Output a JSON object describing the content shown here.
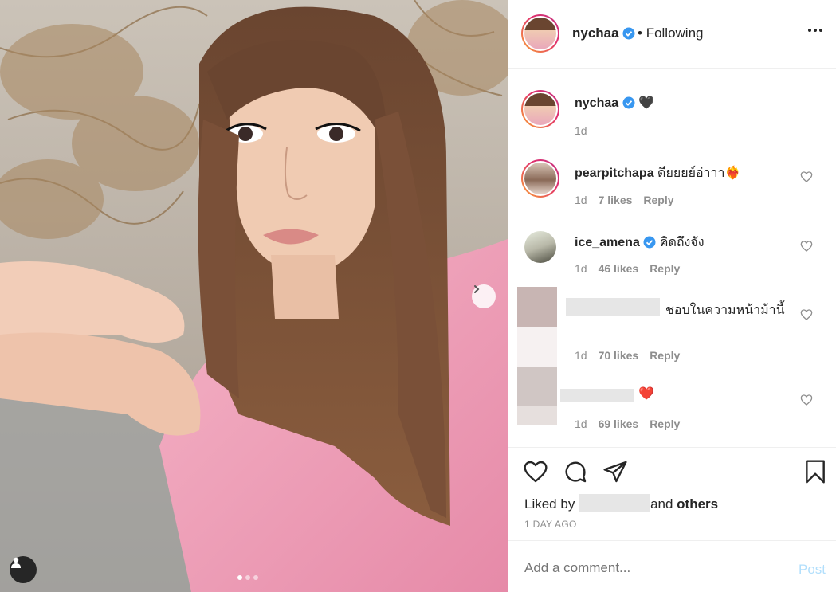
{
  "header": {
    "username": "nychaa",
    "separator": "•",
    "follow_status": "Following"
  },
  "caption": {
    "username": "nychaa",
    "text": "🖤",
    "time": "1d"
  },
  "comments": [
    {
      "username": "pearpitchapa",
      "text": "ดียยยย์อ่าาา❤️‍🔥",
      "time": "1d",
      "likes": "7 likes",
      "reply": "Reply"
    },
    {
      "username": "ice_amena",
      "text": "คิดถึงจัง",
      "time": "1d",
      "likes": "46 likes",
      "reply": "Reply"
    },
    {
      "username": "",
      "text": "ชอบในความหน้าม้านี้",
      "time": "1d",
      "likes": "70 likes",
      "reply": "Reply"
    },
    {
      "username": "",
      "text": "❤️",
      "time": "1d",
      "likes": "69 likes",
      "reply": "Reply"
    }
  ],
  "liked_by": {
    "prefix": "Liked by",
    "connector": "and",
    "suffix": "others"
  },
  "post_date": "1 DAY AGO",
  "add_comment": {
    "placeholder": "Add a comment...",
    "post_label": "Post"
  },
  "carousel": {
    "slides": 3,
    "active_index": 0
  },
  "colors": {
    "verified": "#3897f0",
    "link_disabled": "#b2dffc",
    "muted": "#8e8e8e",
    "text": "#262626"
  },
  "icons": [
    "verified-icon",
    "more-icon",
    "heart-icon",
    "comment-icon",
    "share-icon",
    "bookmark-icon",
    "chevron-right-icon",
    "user-tag-icon"
  ]
}
